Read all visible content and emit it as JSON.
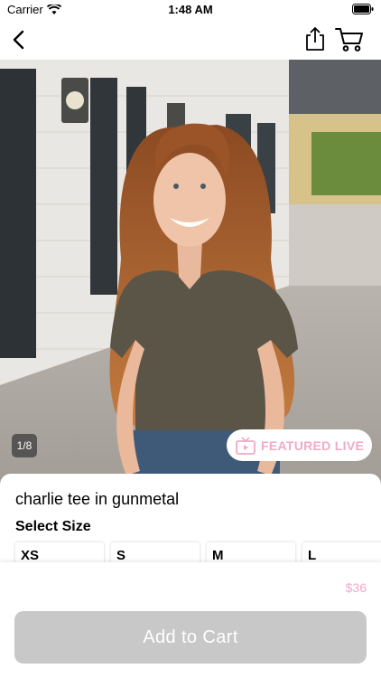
{
  "status_bar": {
    "carrier": "Carrier",
    "time": "1:48 AM"
  },
  "nav": {
    "back_icon": "chevron-left-icon",
    "share_icon": "share-icon",
    "cart_icon": "cart-icon"
  },
  "image": {
    "counter": "1/8"
  },
  "featured_live": {
    "label": "FEATURED LIVE",
    "icon": "tv-play-icon",
    "color": "#f2a9c8"
  },
  "product": {
    "title": "charlie tee in gunmetal",
    "size_label": "Select Size",
    "sizes": [
      "XS",
      "S",
      "M",
      "L"
    ],
    "price": "$36"
  },
  "actions": {
    "add_to_cart": "Add to Cart"
  }
}
